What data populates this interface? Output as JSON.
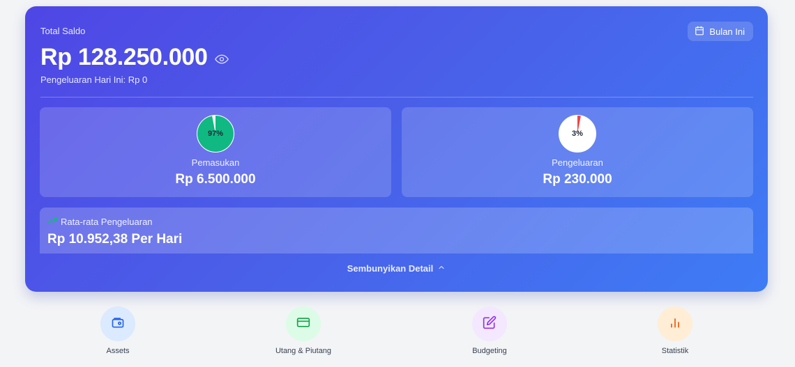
{
  "summary": {
    "total_label": "Total Saldo",
    "balance": "Rp 128.250.000",
    "today_expense": "Pengeluaran Hari Ini: Rp 0",
    "period_button": "Bulan Ini"
  },
  "income": {
    "label": "Pemasukan",
    "value": "Rp 6.500.000",
    "percent_text": "97%",
    "percent": 97,
    "color": "#10b981"
  },
  "expense": {
    "label": "Pengeluaran",
    "value": "Rp 230.000",
    "percent_text": "3%",
    "percent": 3,
    "color": "#ef4444"
  },
  "average": {
    "label": "Rata-rata Pengeluaran",
    "value": "Rp 10.952,38 Per Hari"
  },
  "toggle_label": "Sembunyikan Detail",
  "quick_actions": [
    {
      "label": "Assets",
      "icon": "wallet-icon",
      "bg": "#dbeafe",
      "fg": "#2563eb"
    },
    {
      "label": "Utang & Piutang",
      "icon": "credit-card-icon",
      "bg": "#dcfce7",
      "fg": "#16a34a"
    },
    {
      "label": "Budgeting",
      "icon": "edit-icon",
      "bg": "#f3e8ff",
      "fg": "#9333ea"
    },
    {
      "label": "Statistik",
      "icon": "bar-chart-icon",
      "bg": "#ffedd5",
      "fg": "#ea580c"
    }
  ]
}
